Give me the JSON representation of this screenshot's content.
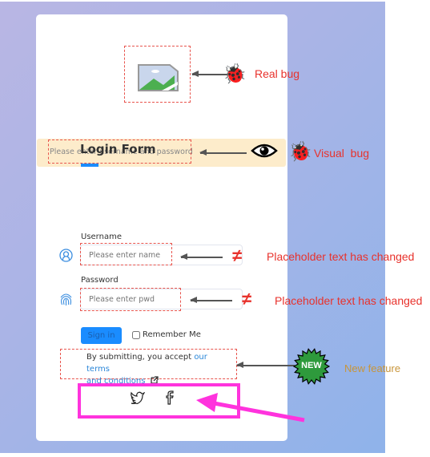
{
  "login_form": {
    "title": "Login Form",
    "banner_text": "Please enter username and password",
    "username": {
      "label": "Username",
      "placeholder": "Please enter name"
    },
    "password": {
      "label": "Password",
      "placeholder": "Please enter pwd"
    },
    "sign_in_label": "Sign in",
    "remember_me_label": "Remember Me",
    "remember_me_checked": false,
    "terms_prefix": "By submitting, you accept ",
    "terms_link_line1": "our terms",
    "terms_link_line2": "and conditions",
    "social_icons": [
      "twitter-icon",
      "facebook-icon"
    ]
  },
  "annotations": {
    "real_bug": "Real bug",
    "visual_bug": "Visual  bug",
    "placeholder_changed_1": "Placeholder text has changed",
    "placeholder_changed_2": "Placeholder text has changed",
    "not_equal_symbol": "≠",
    "new_badge": "NEW",
    "new_feature": "New feature"
  },
  "colors": {
    "accent": "#1a8cff",
    "annotation_red": "#e8322c",
    "highlight": "#ff33dd",
    "new_feature": "#c8953a",
    "banner": "#fdeccb"
  }
}
